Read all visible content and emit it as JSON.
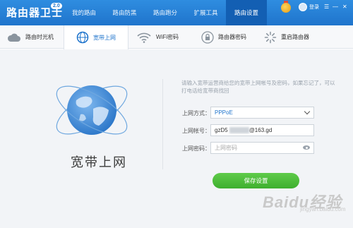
{
  "app": {
    "title": "路由器卫士",
    "version": "2.0"
  },
  "nav": {
    "tabs": [
      {
        "label": "我的路由"
      },
      {
        "label": "路由防黑"
      },
      {
        "label": "路由跑分"
      },
      {
        "label": "扩展工具"
      },
      {
        "label": "路由设置",
        "active": true
      }
    ],
    "login_label": "登录",
    "window_controls": [
      "☰",
      "—",
      "✕"
    ]
  },
  "subnav": {
    "tabs": [
      {
        "label": "路由时光机",
        "icon": "cloud-icon"
      },
      {
        "label": "宽带上网",
        "icon": "globe-icon",
        "active": true
      },
      {
        "label": "WiFi密码",
        "icon": "wifi-icon"
      },
      {
        "label": "路由器密码",
        "icon": "lock-icon"
      },
      {
        "label": "重启路由器",
        "icon": "restart-icon"
      }
    ]
  },
  "page": {
    "heading": "宽带上网",
    "hint": "请输入宽带运营商给您的宽带上网帐号及密码，如果忘记了，可以打电话给宽带商找回",
    "form": {
      "mode_label": "上网方式：",
      "mode_value": "PPPoE",
      "account_label": "上网帐号：",
      "account_value_prefix": "gzD5",
      "account_value_suffix": "@163.gd",
      "password_label": "上网密码：",
      "password_placeholder": "上网密码"
    },
    "save_label": "保存设置"
  },
  "watermark": {
    "text": "Baidu经验",
    "sub": "jingyan.baidu.com"
  },
  "colors": {
    "brand_blue": "#1f74cc",
    "active_tab": "#135fb3",
    "save_green": "#3eaf2e"
  }
}
